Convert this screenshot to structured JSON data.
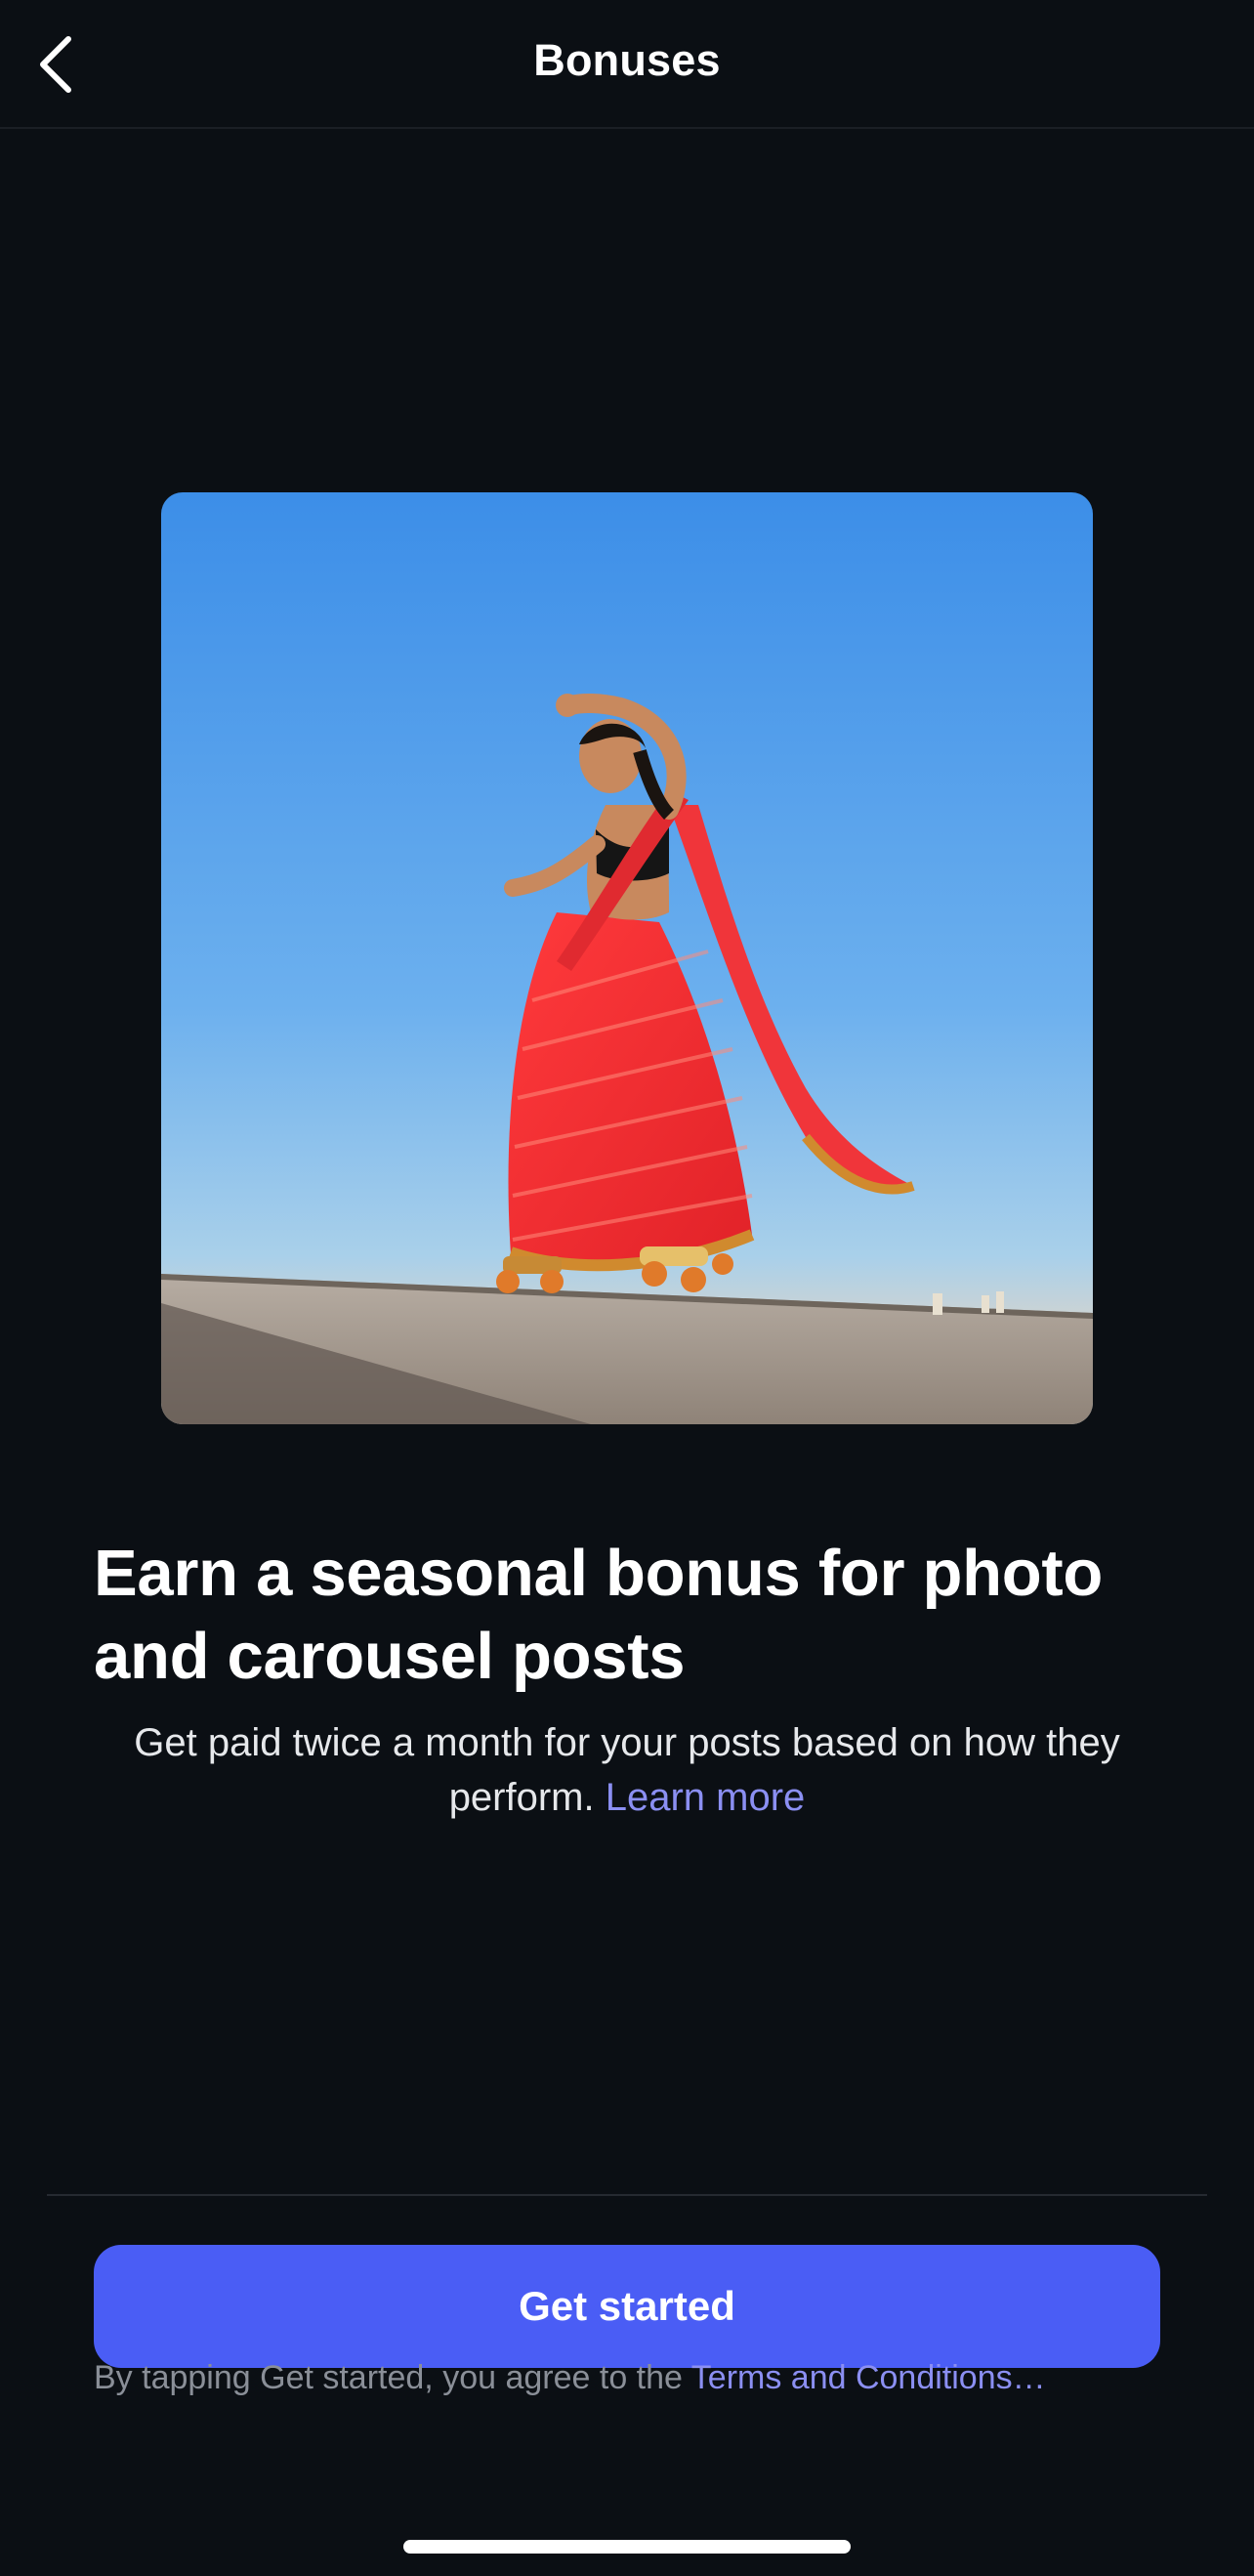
{
  "header": {
    "title": "Bonuses",
    "back_icon": "chevron-left-icon"
  },
  "hero": {
    "image": "woman-in-red-saree-on-roller-skates-photo",
    "colors": {
      "sky_top": "#3d8fe8",
      "sky_bottom": "#9ec9ea",
      "ground": "#b9aea2",
      "saree": "#f12f34"
    }
  },
  "content": {
    "headline": "Earn a seasonal bonus for photo and carousel posts",
    "subtext_before": "Get paid twice a month for your posts based on how they perform.",
    "learn_more": "Learn more"
  },
  "footer": {
    "cta_label": "Get started",
    "terms_prefix": "By tapping Get started, you agree to the",
    "terms_link": "Terms and Conditions…"
  },
  "colors": {
    "background": "#0b0f14",
    "accent": "#4a5df5",
    "link": "#8b8ff2"
  }
}
